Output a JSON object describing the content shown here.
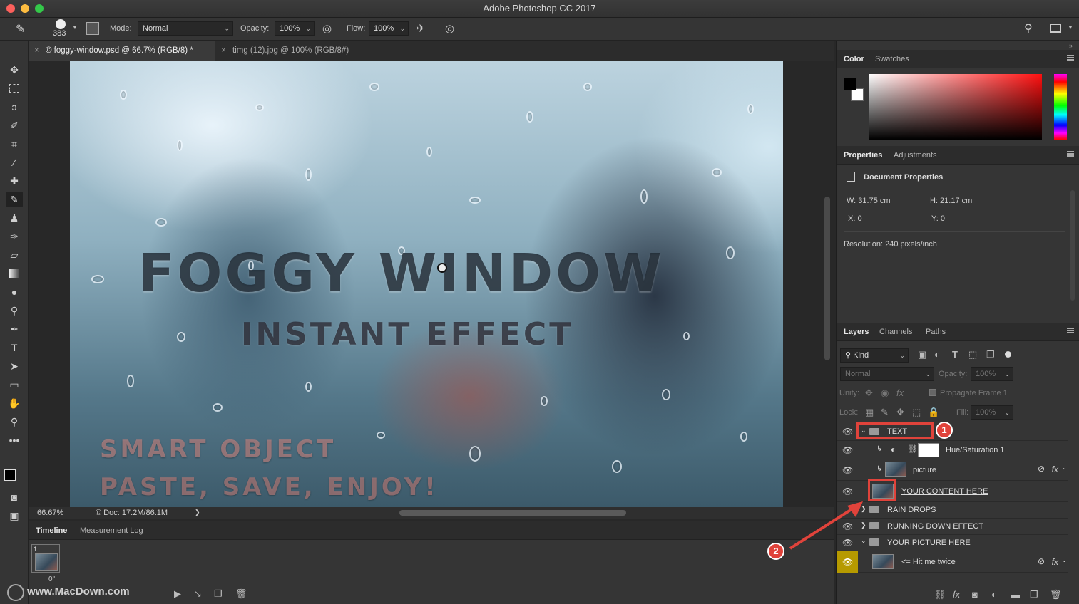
{
  "app": {
    "title": "Adobe Photoshop CC 2017"
  },
  "options": {
    "brush_size": "383",
    "mode_label": "Mode:",
    "mode_value": "Normal",
    "opacity_label": "Opacity:",
    "opacity_value": "100%",
    "flow_label": "Flow:",
    "flow_value": "100%"
  },
  "doc_tabs": [
    {
      "label": "© foggy-window.psd @ 66.7% (RGB/8) *",
      "close": "×"
    },
    {
      "label": "timg (12).jpg @ 100% (RGB/8#)",
      "close": "×"
    }
  ],
  "canvas": {
    "title": "FOGGY WINDOW",
    "subtitle": "INSTANT EFFECT",
    "line1": "SMART OBJECT",
    "line2": "PASTE, SAVE, ENJOY!"
  },
  "status": {
    "zoom": "66.67%",
    "doc": "© Doc: 17.2M/86.1M",
    "arrow": "❯"
  },
  "timeline": {
    "tabs": [
      "Timeline",
      "Measurement Log"
    ],
    "frame_number": "1",
    "frame_delay": "0\"",
    "watermark": "www.MacDown.com"
  },
  "color_panel": {
    "tabs": [
      "Color",
      "Swatches"
    ]
  },
  "properties": {
    "tabs": [
      "Properties",
      "Adjustments"
    ],
    "heading": "Document Properties",
    "w": "W:  31.75 cm",
    "h": "H:  21.17 cm",
    "x": "X:  0",
    "y": "Y:  0",
    "resolution": "Resolution: 240 pixels/inch"
  },
  "layers_panel": {
    "tabs": [
      "Layers",
      "Channels",
      "Paths"
    ],
    "filter": "Kind",
    "blend": "Normal",
    "opacity_label": "Opacity:",
    "opacity_value": "100%",
    "unify_label": "Unify:",
    "propagate": "Propagate Frame 1",
    "lock_label": "Lock:",
    "fill_label": "Fill:",
    "fill_value": "100%",
    "layers": [
      {
        "name": "TEXT"
      },
      {
        "name": "Hue/Saturation 1"
      },
      {
        "name": "picture"
      },
      {
        "name": "YOUR CONTENT HERE"
      },
      {
        "name": "RAIN DROPS"
      },
      {
        "name": "RUNNING DOWN EFFECT"
      },
      {
        "name": "YOUR PICTURE HERE"
      },
      {
        "name": "<= Hit me twice"
      }
    ]
  },
  "annotations": {
    "badge1": "1",
    "badge2": "2",
    "accent": "#e0433b"
  }
}
